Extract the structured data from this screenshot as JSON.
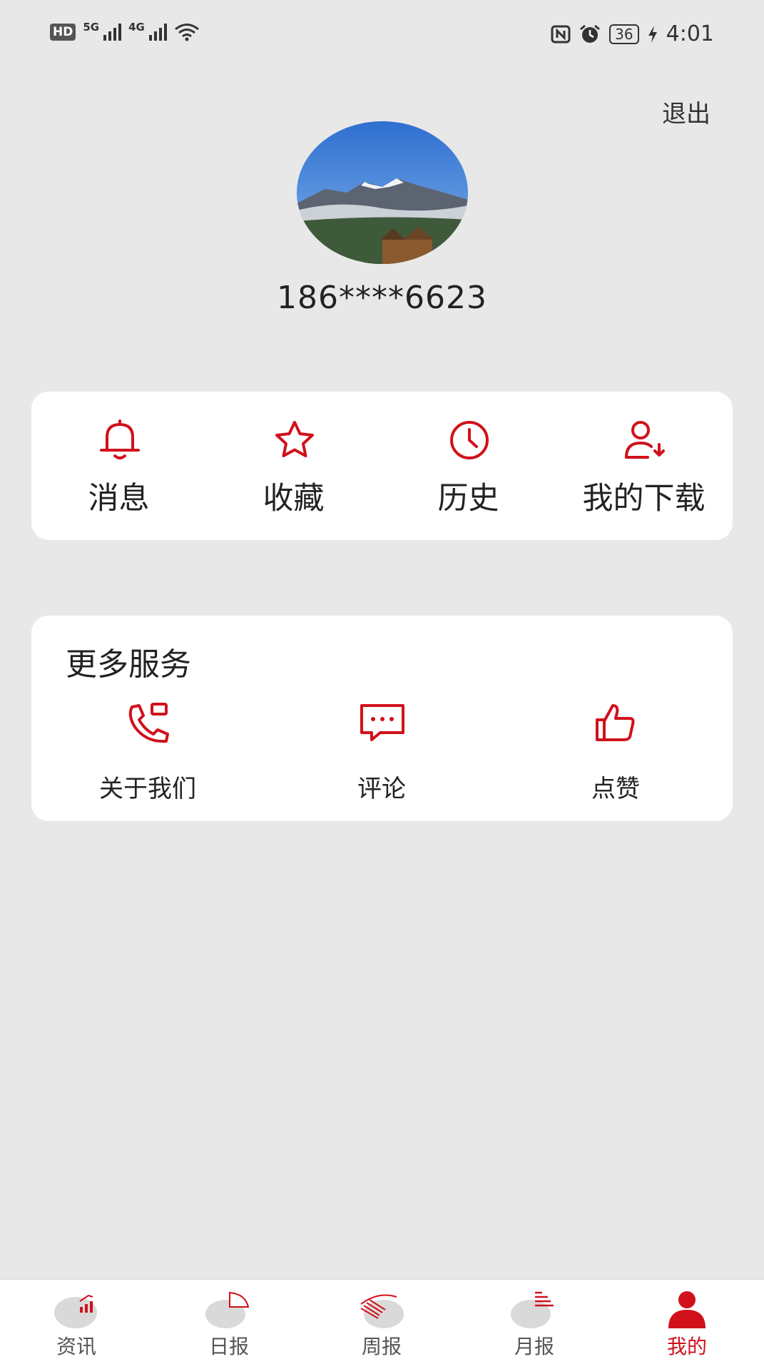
{
  "status_bar": {
    "hd_label": "HD",
    "net1_label": "5G",
    "net2_label": "4G",
    "battery": "36",
    "time": "4:01"
  },
  "header": {
    "logout_label": "退出"
  },
  "profile": {
    "phone": "186****6623"
  },
  "quick_actions": [
    {
      "label": "消息",
      "icon": "bell-icon"
    },
    {
      "label": "收藏",
      "icon": "star-icon"
    },
    {
      "label": "历史",
      "icon": "clock-icon"
    },
    {
      "label": "我的下载",
      "icon": "user-download-icon"
    }
  ],
  "services": {
    "title": "更多服务",
    "items": [
      {
        "label": "关于我们",
        "icon": "phone-icon"
      },
      {
        "label": "评论",
        "icon": "comment-icon"
      },
      {
        "label": "点赞",
        "icon": "thumbs-up-icon"
      }
    ]
  },
  "tabs": [
    {
      "label": "资讯",
      "icon": "news-chart-icon",
      "active": false
    },
    {
      "label": "日报",
      "icon": "daily-pie-icon",
      "active": false
    },
    {
      "label": "周报",
      "icon": "weekly-fan-icon",
      "active": false
    },
    {
      "label": "月报",
      "icon": "monthly-bars-icon",
      "active": false
    },
    {
      "label": "我的",
      "icon": "user-icon",
      "active": true
    }
  ],
  "colors": {
    "accent": "#d0111b",
    "background": "#e8e8e8",
    "card": "#ffffff"
  }
}
